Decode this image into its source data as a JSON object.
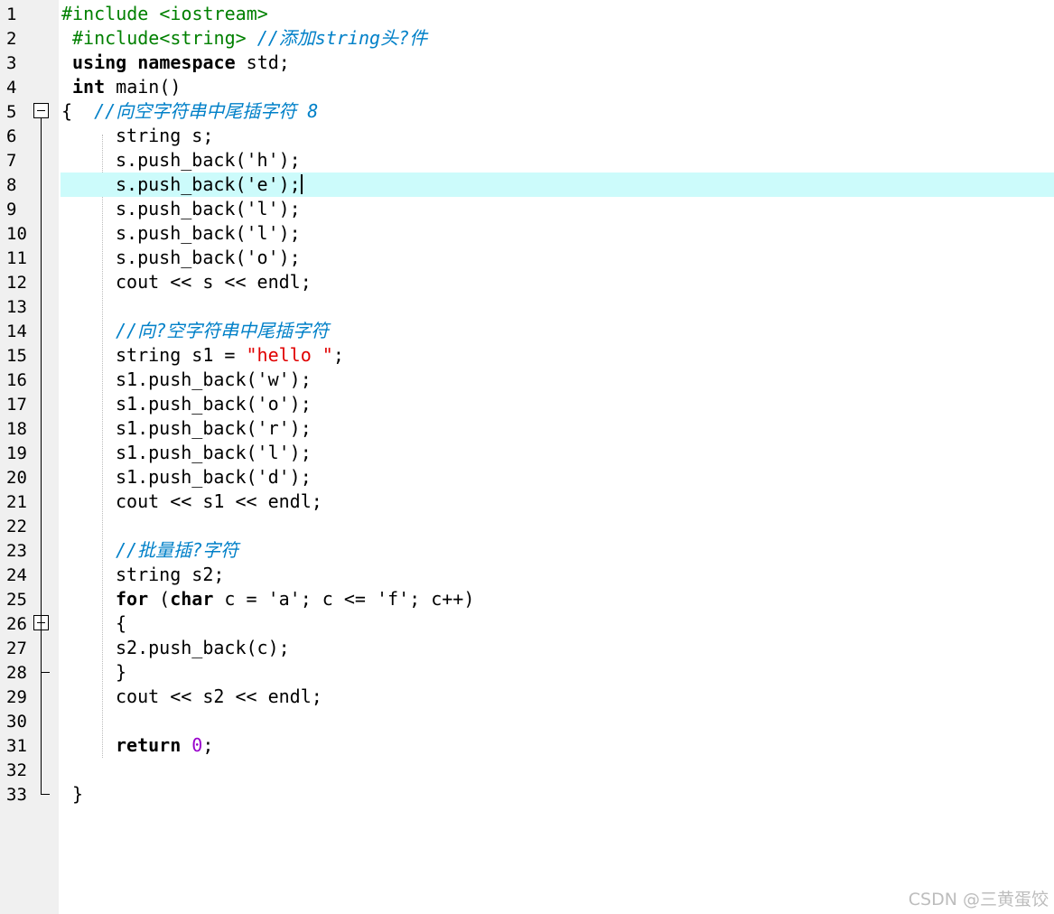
{
  "editor": {
    "lines": [
      {
        "num": "1",
        "segs": [
          [
            "pp",
            "#include <iostream>"
          ]
        ]
      },
      {
        "num": "2",
        "segs": [
          [
            "pp",
            "#include<string> "
          ],
          [
            "cm",
            "//添加string头?件"
          ]
        ]
      },
      {
        "num": "3",
        "segs": [
          [
            "kw",
            "using"
          ],
          [
            "",
            " "
          ],
          [
            "kw",
            "namespace"
          ],
          [
            "",
            " std;"
          ]
        ]
      },
      {
        "num": "4",
        "segs": [
          [
            "kw",
            "int"
          ],
          [
            "",
            " main()"
          ]
        ]
      },
      {
        "num": "5",
        "segs": [
          [
            "",
            "{  "
          ],
          [
            "cm",
            "//向空字符串中尾插字符 8"
          ]
        ]
      },
      {
        "num": "6",
        "segs": [
          [
            "",
            "string s;"
          ]
        ]
      },
      {
        "num": "7",
        "segs": [
          [
            "",
            "s.push_back('h');"
          ]
        ]
      },
      {
        "num": "8",
        "segs": [
          [
            "",
            "s.push_back('e');"
          ]
        ]
      },
      {
        "num": "9",
        "segs": [
          [
            "",
            "s.push_back('l');"
          ]
        ]
      },
      {
        "num": "10",
        "segs": [
          [
            "",
            "s.push_back('l');"
          ]
        ]
      },
      {
        "num": "11",
        "segs": [
          [
            "",
            "s.push_back('o');"
          ]
        ]
      },
      {
        "num": "12",
        "segs": [
          [
            "",
            "cout << s << endl;"
          ]
        ]
      },
      {
        "num": "13",
        "segs": []
      },
      {
        "num": "14",
        "segs": [
          [
            "cm",
            "//向?空字符串中尾插字符"
          ]
        ]
      },
      {
        "num": "15",
        "segs": [
          [
            "",
            "string s1 = "
          ],
          [
            "str",
            "\"hello \""
          ],
          [
            "",
            ";"
          ]
        ]
      },
      {
        "num": "16",
        "segs": [
          [
            "",
            "s1.push_back('w');"
          ]
        ]
      },
      {
        "num": "17",
        "segs": [
          [
            "",
            "s1.push_back('o');"
          ]
        ]
      },
      {
        "num": "18",
        "segs": [
          [
            "",
            "s1.push_back('r');"
          ]
        ]
      },
      {
        "num": "19",
        "segs": [
          [
            "",
            "s1.push_back('l');"
          ]
        ]
      },
      {
        "num": "20",
        "segs": [
          [
            "",
            "s1.push_back('d');"
          ]
        ]
      },
      {
        "num": "21",
        "segs": [
          [
            "",
            "cout << s1 << endl;"
          ]
        ]
      },
      {
        "num": "22",
        "segs": []
      },
      {
        "num": "23",
        "segs": [
          [
            "cm",
            "//批量插?字符"
          ]
        ]
      },
      {
        "num": "24",
        "segs": [
          [
            "",
            "string s2;"
          ]
        ]
      },
      {
        "num": "25",
        "segs": [
          [
            "kw",
            "for"
          ],
          [
            "",
            " ("
          ],
          [
            "kw",
            "char"
          ],
          [
            "",
            " c = 'a'; c <= 'f'; c++)"
          ]
        ]
      },
      {
        "num": "26",
        "segs": [
          [
            "",
            "{"
          ]
        ]
      },
      {
        "num": "27",
        "segs": [
          [
            "",
            "s2.push_back(c);"
          ]
        ]
      },
      {
        "num": "28",
        "segs": [
          [
            "",
            "}"
          ]
        ]
      },
      {
        "num": "29",
        "segs": [
          [
            "",
            "cout << s2 << endl;"
          ]
        ]
      },
      {
        "num": "30",
        "segs": []
      },
      {
        "num": "31",
        "segs": [
          [
            "kw",
            "return"
          ],
          [
            "",
            " "
          ],
          [
            "num",
            "0"
          ],
          [
            "",
            ";"
          ]
        ]
      },
      {
        "num": "32",
        "segs": []
      },
      {
        "num": "33",
        "segs": [
          [
            "",
            "}"
          ]
        ]
      }
    ],
    "current_line": "8"
  },
  "watermark": "CSDN @三黄蛋饺"
}
